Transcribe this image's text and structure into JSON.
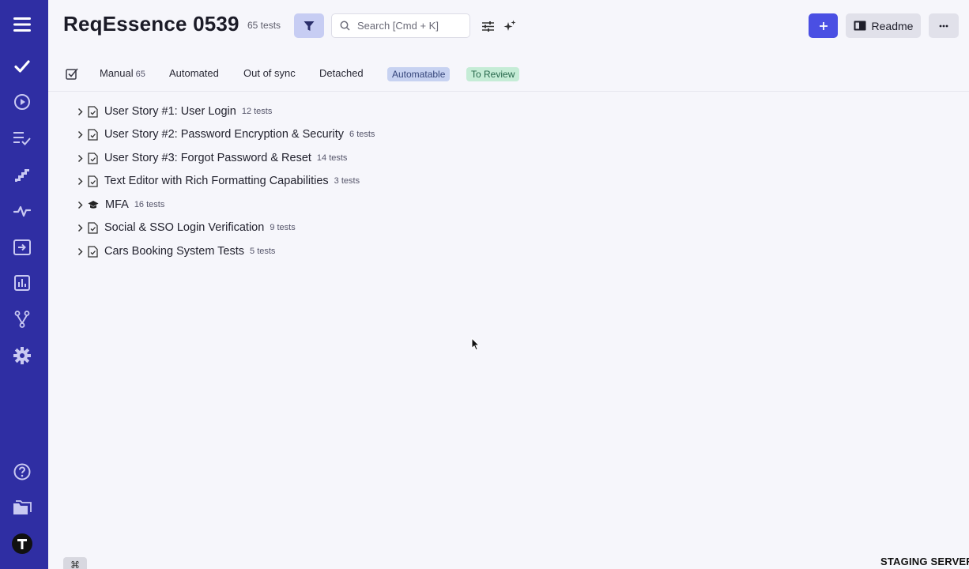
{
  "header": {
    "title": "ReqEssence 0539",
    "test_count": "65 tests",
    "search_placeholder": "Search [Cmd + K]",
    "readme_label": "Readme",
    "add_label": "+"
  },
  "tabs": [
    {
      "label": "Manual",
      "count": "65"
    },
    {
      "label": "Automated"
    },
    {
      "label": "Out of sync"
    },
    {
      "label": "Detached"
    }
  ],
  "chips": [
    {
      "label": "Automatable",
      "color": "#c7d2f1"
    },
    {
      "label": "To Review",
      "color": "#c5ecd6"
    }
  ],
  "suites": [
    {
      "name": "User Story #1: User Login",
      "count": "12 tests",
      "icon": "document-check-icon"
    },
    {
      "name": "User Story #2: Password Encryption & Security",
      "count": "6 tests",
      "icon": "document-check-icon"
    },
    {
      "name": "User Story #3: Forgot Password & Reset",
      "count": "14 tests",
      "icon": "document-check-icon"
    },
    {
      "name": "Text Editor with Rich Formatting Capabilities",
      "count": "3 tests",
      "icon": "document-check-icon"
    },
    {
      "name": "MFA",
      "count": "16 tests",
      "icon": "graduation-cap-icon"
    },
    {
      "name": "Social & SSO Login Verification",
      "count": "9 tests",
      "icon": "document-check-icon"
    },
    {
      "name": "Cars Booking System Tests",
      "count": "5 tests",
      "icon": "document-check-icon"
    }
  ],
  "sidebar": {
    "items": [
      "menu-icon",
      "tests-check-icon",
      "runs-play-icon",
      "plans-list-icon",
      "steps-icon",
      "pulse-icon",
      "import-icon",
      "analytics-icon",
      "branches-icon",
      "settings-gear-icon",
      "help-icon",
      "projects-folder-icon",
      "app-logo"
    ],
    "color": "#2f2ea3"
  },
  "footer": {
    "cmd_key": "⌘",
    "environment": "STAGING SERVER"
  },
  "colors": {
    "accent": "#4a4fe3",
    "background": "#f6f6fb"
  }
}
